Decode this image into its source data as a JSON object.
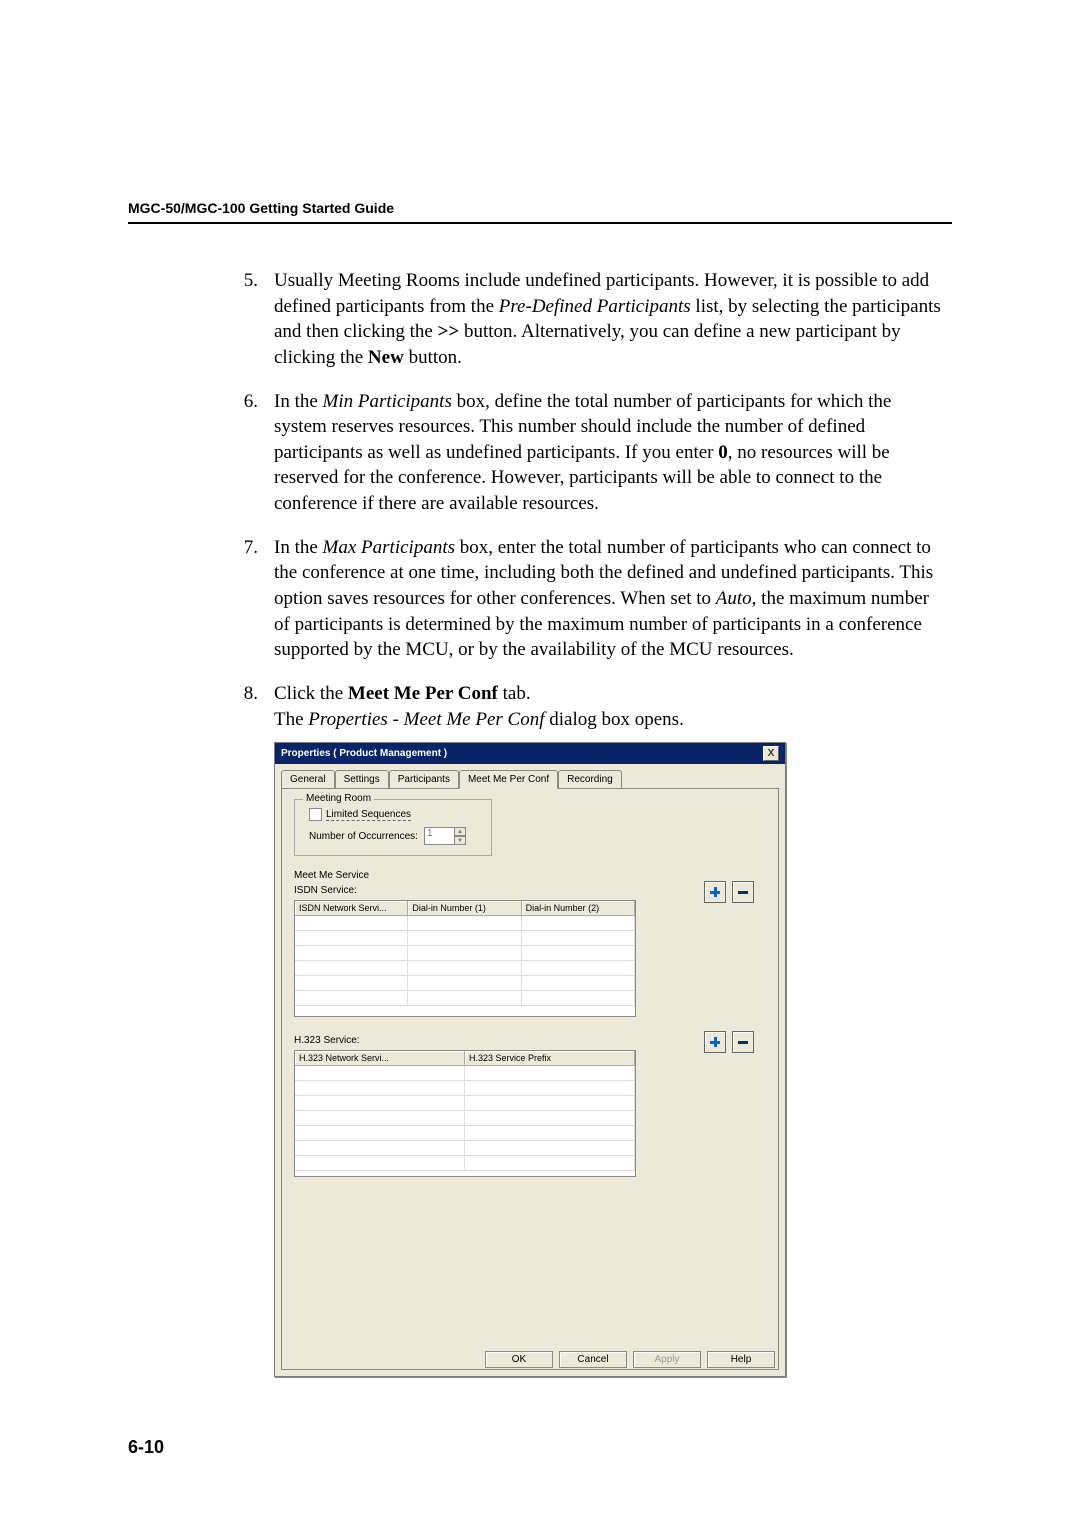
{
  "header": "MGC-50/MGC-100 Getting Started Guide",
  "items": {
    "5": {
      "num": "5.",
      "t1": "Usually Meeting Rooms include undefined participants. However, it is possible to add defined participants from the ",
      "i1": "Pre-Defined Participants",
      "t2": " list, by selecting the participants and then clicking the ",
      "b1": ">>",
      "t3": " button. Alternatively, you can define a new participant by clicking the ",
      "b2": "New",
      "t4": " button."
    },
    "6": {
      "num": "6.",
      "t1": "In the ",
      "i1": "Min Participants",
      "t2": " box, define the total number of participants for which the system reserves resources. This number should include the number of defined participants as well as undefined participants. If you enter ",
      "b1": "0",
      "t3": ", no resources will be reserved for the conference. However, participants will be able to connect to the conference if there are available resources."
    },
    "7": {
      "num": "7.",
      "t1": "In the ",
      "i1": "Max Participants",
      "t2": " box, enter the total number of participants who can connect to the conference at one time, including both the defined and undefined participants. This option saves resources for other conferences. When set to ",
      "i2": "Auto",
      "t3": ", the maximum number of participants is determined by the maximum number of participants in a conference supported by the MCU, or by the availability of the MCU resources."
    },
    "8": {
      "num": "8.",
      "t1": "Click the ",
      "b1": "Meet Me Per Conf",
      "t2": " tab.",
      "l2a": "The ",
      "l2i": "Properties - Meet Me Per Conf",
      "l2b": " dialog box opens."
    }
  },
  "dialog": {
    "title": "Properties ( Product Management )",
    "close": "X",
    "tabs": [
      "General",
      "Settings",
      "Participants",
      "Meet Me Per Conf",
      "Recording"
    ],
    "group_meeting": "Meeting Room",
    "limited": "Limited Sequences",
    "num_occ_label": "Number of Occurrences:",
    "num_occ_val": "1",
    "meet_me_service": "Meet Me Service",
    "isdn_service": "ISDN Service:",
    "isdn_headers": [
      "ISDN Network Servi...",
      "Dial-in Number (1)",
      "Dial-in Number (2)"
    ],
    "h323_service": "H.323 Service:",
    "h323_headers": [
      "H.323 Network Servi...",
      "H.323 Service Prefix"
    ],
    "buttons": {
      "ok": "OK",
      "cancel": "Cancel",
      "apply": "Apply",
      "help": "Help"
    }
  },
  "page_number": "6-10"
}
